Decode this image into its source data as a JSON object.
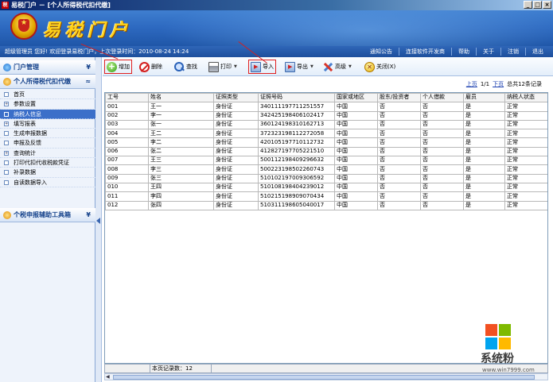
{
  "window": {
    "title": "易税门户 － [个人所得税代扣代缴]",
    "title_icon": "税",
    "buttons": [
      "_",
      "□",
      "×"
    ]
  },
  "banner": {
    "brand": "易税门户"
  },
  "statusbar": {
    "welcome": "超级管理员 您好! 欢迎登录易税门户，上次登录时间：2010-08-24 14:24",
    "links": [
      "通知公告",
      "连接软件开发商",
      "帮助",
      "关于",
      "注销",
      "退出"
    ]
  },
  "sidebar": {
    "sections": [
      {
        "label": "门户管理",
        "chevron": "¥"
      },
      {
        "label": "个人所得税代扣代缴",
        "chevron": "≈"
      },
      {
        "label": "个税申报辅助工具箱",
        "chevron": "¥"
      }
    ],
    "items": [
      {
        "label": "首页",
        "marker": ""
      },
      {
        "label": "参数设置",
        "marker": "+"
      },
      {
        "label": "纳税人信息",
        "marker": ""
      },
      {
        "label": "填写报表",
        "marker": "+"
      },
      {
        "label": "生成申报数据",
        "marker": ""
      },
      {
        "label": "申报及反馈",
        "marker": ""
      },
      {
        "label": "查询统计",
        "marker": "+"
      },
      {
        "label": "打印代扣代收税款凭证",
        "marker": ""
      },
      {
        "label": "补录数据",
        "marker": ""
      },
      {
        "label": "自读数据导入",
        "marker": ""
      }
    ],
    "active_index": 2
  },
  "toolbar": {
    "add": "增加",
    "delete": "删除",
    "find": "查找",
    "print": "打印",
    "import": "导入",
    "export": "导出",
    "advanced": "高级",
    "close": "关闭(X)"
  },
  "pager": {
    "prev": "上页",
    "page": "1/1",
    "next": "下页",
    "total": "总共12条记录"
  },
  "table": {
    "columns": [
      "工号",
      "姓名",
      "证照类型",
      "证照号码",
      "国家或地区",
      "股东/投资者",
      "个人借款",
      "雇员",
      "纳税人状态"
    ],
    "rows": [
      [
        "001",
        "王一",
        "身份证",
        "340111197711251557",
        "中国",
        "否",
        "否",
        "是",
        "正常"
      ],
      [
        "002",
        "李一",
        "身份证",
        "342425198406102417",
        "中国",
        "否",
        "否",
        "是",
        "正常"
      ],
      [
        "003",
        "张一",
        "身份证",
        "360124198310162713",
        "中国",
        "否",
        "否",
        "是",
        "正常"
      ],
      [
        "004",
        "王二",
        "身份证",
        "372323198112272058",
        "中国",
        "否",
        "否",
        "是",
        "正常"
      ],
      [
        "005",
        "李二",
        "身份证",
        "420105197710112732",
        "中国",
        "否",
        "否",
        "是",
        "正常"
      ],
      [
        "006",
        "张二",
        "身份证",
        "412827197705221510",
        "中国",
        "否",
        "否",
        "是",
        "正常"
      ],
      [
        "007",
        "王三",
        "身份证",
        "500112198409296632",
        "中国",
        "否",
        "否",
        "是",
        "正常"
      ],
      [
        "008",
        "李三",
        "身份证",
        "500223198502260743",
        "中国",
        "否",
        "否",
        "是",
        "正常"
      ],
      [
        "009",
        "张三",
        "身份证",
        "510102197009306592",
        "中国",
        "否",
        "否",
        "是",
        "正常"
      ],
      [
        "010",
        "王四",
        "身份证",
        "510108198404239012",
        "中国",
        "否",
        "否",
        "是",
        "正常"
      ],
      [
        "011",
        "李四",
        "身份证",
        "510215198909070434",
        "中国",
        "否",
        "否",
        "是",
        "正常"
      ],
      [
        "012",
        "张四",
        "身份证",
        "510311198605040017",
        "中国",
        "否",
        "否",
        "是",
        "正常"
      ]
    ]
  },
  "footer": {
    "record_count": "本页记录数：12"
  },
  "watermark": {
    "text": "系统粉",
    "url": "www.win7999.com",
    "colors": [
      "#f25022",
      "#7fba00",
      "#00a4ef",
      "#ffb900"
    ]
  },
  "colors": {
    "banner": "#2e6ac1",
    "brand_text": "#ffd21a",
    "active_item": "#3b6fc9",
    "highlight": "#e02020"
  }
}
